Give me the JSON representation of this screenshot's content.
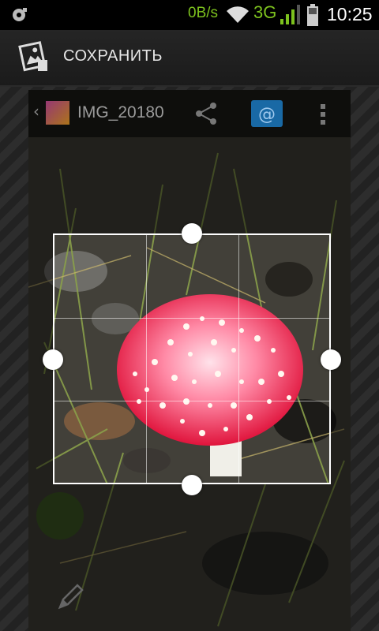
{
  "status_bar": {
    "net_speed": "0B/s",
    "network_type": "3G",
    "time": "10:25",
    "icons": [
      "notification-icon",
      "wifi-icon",
      "signal-icon",
      "battery-icon"
    ]
  },
  "action_bar": {
    "save_label": "СОХРАНИТЬ",
    "save_icon": "save-picture-icon"
  },
  "gallery_bar": {
    "filename": "IMG_20180",
    "icons": [
      "back-chevron-icon",
      "thumbnail-icon",
      "share-icon",
      "email-icon",
      "overflow-menu-icon"
    ]
  },
  "editor": {
    "crop_handles": [
      "top",
      "left",
      "right",
      "bottom"
    ],
    "bottom_tool_icon": "pencil-icon"
  },
  "colors": {
    "accent_green": "#7dc21e",
    "mail_blue": "#1e88d8"
  }
}
